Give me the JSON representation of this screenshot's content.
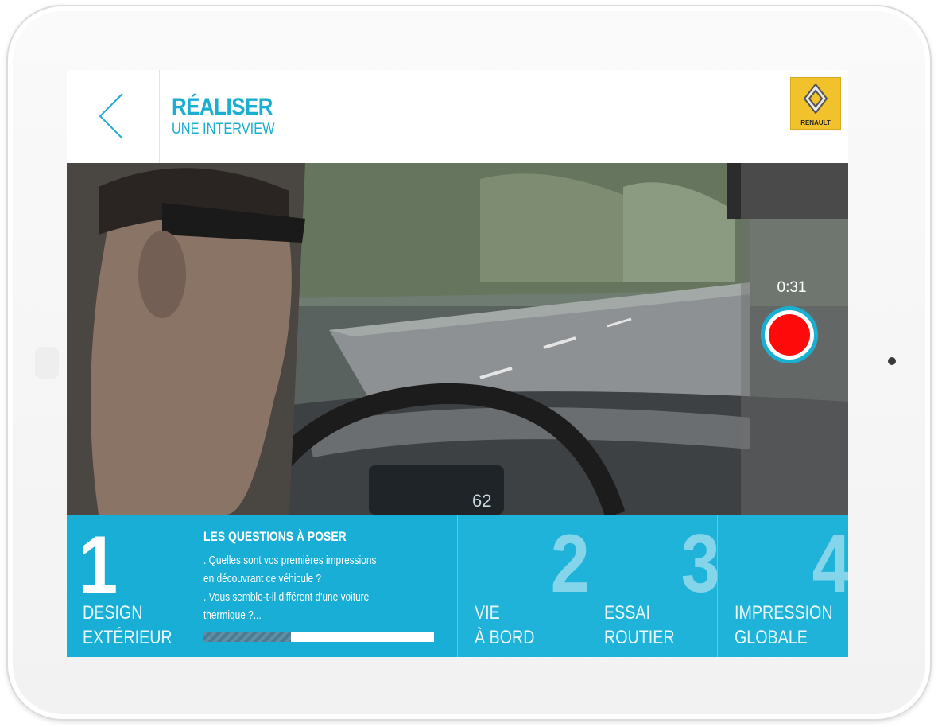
{
  "header": {
    "title": "RÉALISER",
    "subtitle": "UNE INTERVIEW",
    "logo_text": "RENAULT"
  },
  "recorder": {
    "timer": "0:31",
    "recording_color": "#ff0a0a"
  },
  "steps": [
    {
      "number": "1",
      "label_line1": "DESIGN",
      "label_line2": "EXTÉRIEUR",
      "active": true
    },
    {
      "number": "2",
      "label_line1": "VIE",
      "label_line2": "À BORD",
      "active": false
    },
    {
      "number": "3",
      "label_line1": "ESSAI",
      "label_line2": "ROUTIER",
      "active": false
    },
    {
      "number": "4",
      "label_line1": "IMPRESSION",
      "label_line2": "GLOBALE",
      "active": false
    }
  ],
  "questions": {
    "title": "LES QUESTIONS À POSER",
    "lines": [
      ". Quelles sont vos premières impressions",
      "en découvrant ce véhicule ?",
      ". Vous semble-t-il différent d'une voiture",
      "thermique ?..."
    ],
    "progress": 0.38
  },
  "colors": {
    "accent": "#1aaed1",
    "steps_bg": "#1fb3d9",
    "logo_bg": "#f2c22c"
  },
  "icons": [
    "back-chevron-icon",
    "renault-logo",
    "record-icon"
  ]
}
